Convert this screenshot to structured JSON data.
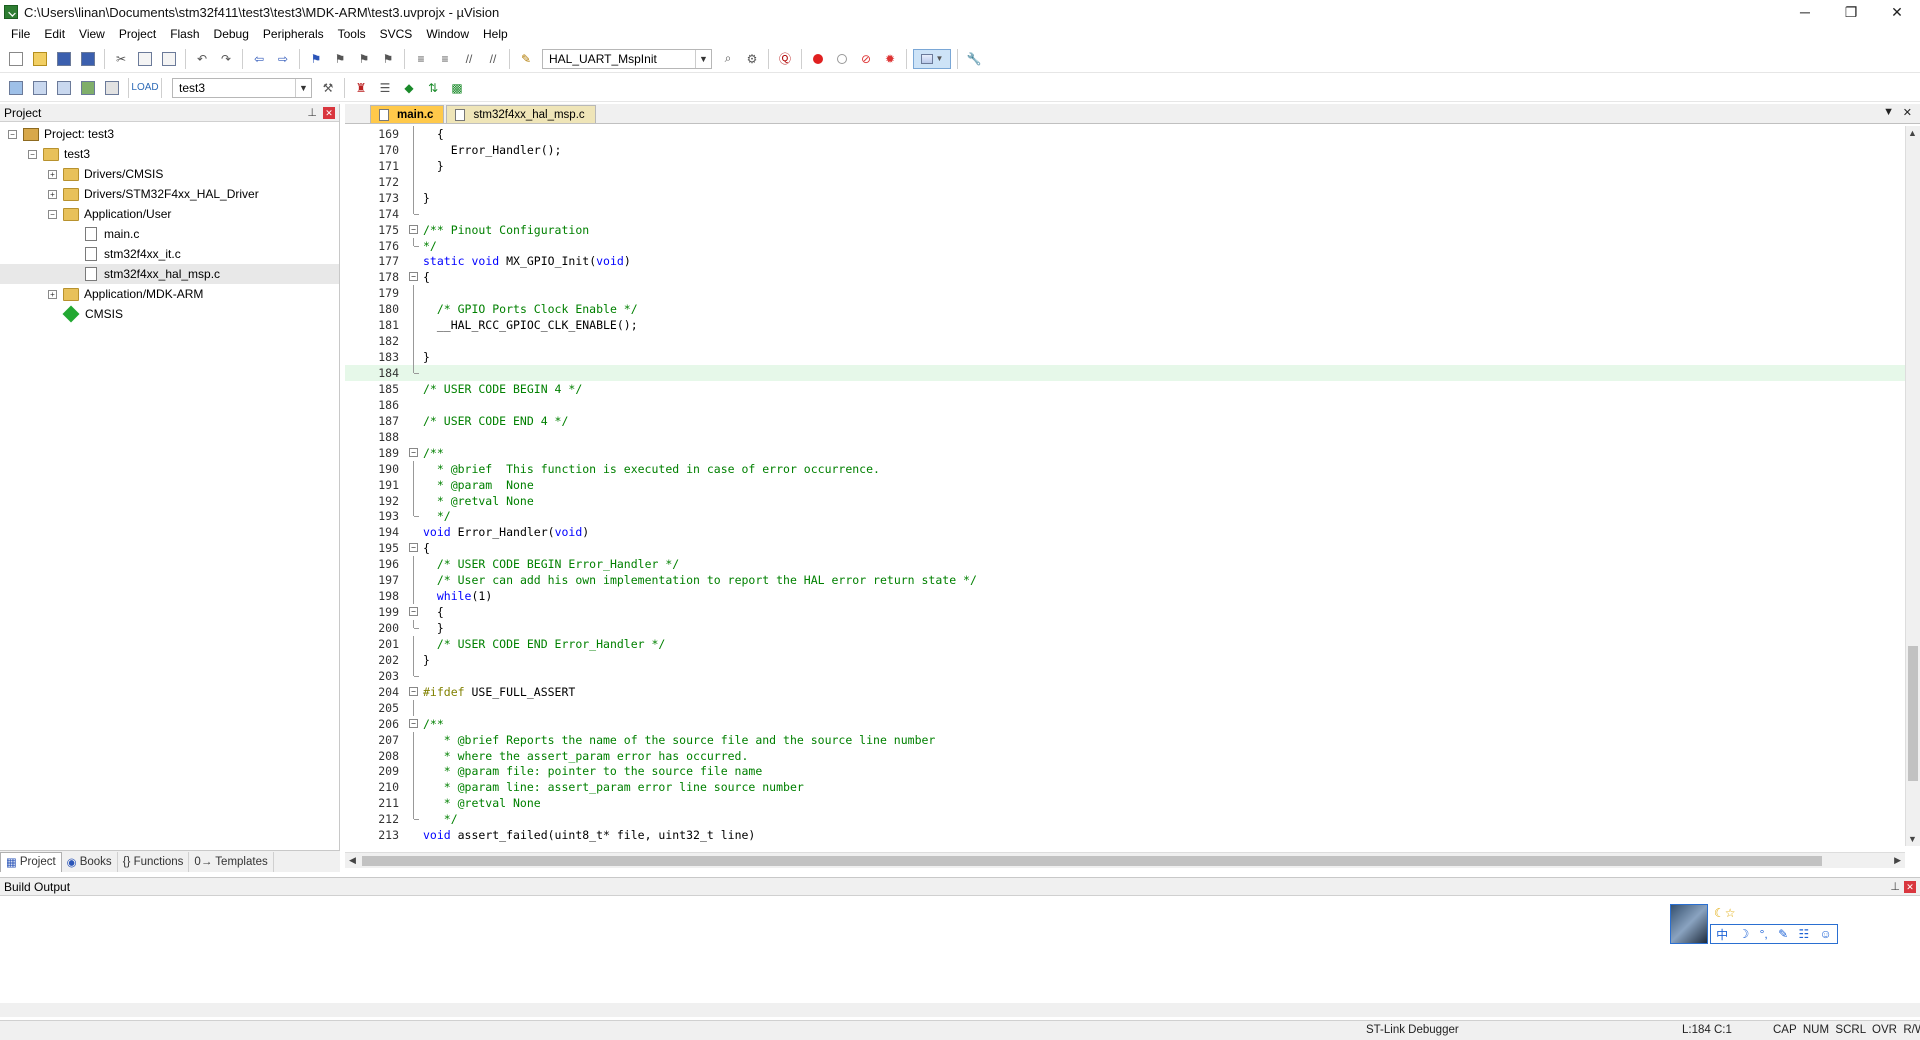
{
  "window": {
    "title": "C:\\Users\\linan\\Documents\\stm32f411\\test3\\test3\\MDK-ARM\\test3.uvprojx - µVision",
    "controls": [
      "─",
      "❐",
      "✕"
    ]
  },
  "menu": [
    "File",
    "Edit",
    "View",
    "Project",
    "Flash",
    "Debug",
    "Peripherals",
    "Tools",
    "SVCS",
    "Window",
    "Help"
  ],
  "toolbar1": {
    "function_combo": "HAL_UART_MspInit"
  },
  "toolbar2": {
    "target_combo": "test3"
  },
  "project_panel": {
    "title": "Project",
    "tree": [
      {
        "label": "Project: test3",
        "level": 0,
        "icon": "project-icon",
        "expander": "⊟"
      },
      {
        "label": "test3",
        "level": 1,
        "icon": "folder-icon",
        "expander": "⊟"
      },
      {
        "label": "Drivers/CMSIS",
        "level": 2,
        "icon": "folder-icon",
        "expander": "⊞"
      },
      {
        "label": "Drivers/STM32F4xx_HAL_Driver",
        "level": 2,
        "icon": "folder-icon",
        "expander": "⊞"
      },
      {
        "label": "Application/User",
        "level": 2,
        "icon": "folder-open-icon",
        "expander": "⊟"
      },
      {
        "label": "main.c",
        "level": 3,
        "icon": "file-icon",
        "expander": ""
      },
      {
        "label": "stm32f4xx_it.c",
        "level": 3,
        "icon": "file-icon",
        "expander": ""
      },
      {
        "label": "stm32f4xx_hal_msp.c",
        "level": 3,
        "icon": "file-icon",
        "expander": "",
        "selected": true
      },
      {
        "label": "Application/MDK-ARM",
        "level": 2,
        "icon": "folder-icon",
        "expander": "⊞"
      },
      {
        "label": "CMSIS",
        "level": 2,
        "icon": "cmsis-gem-icon",
        "expander": ""
      }
    ],
    "tabs": [
      "Project",
      "Books",
      "{} Functions",
      "0→ Templates"
    ]
  },
  "editor": {
    "tabs": [
      {
        "label": "main.c",
        "active": true
      },
      {
        "label": "stm32f4xx_hal_msp.c",
        "active": false
      }
    ],
    "current_line": 184,
    "lines": [
      {
        "n": "169",
        "fold": "vl",
        "segs": [
          [
            "",
            "  {"
          ]
        ]
      },
      {
        "n": "170",
        "fold": "vl",
        "segs": [
          [
            "",
            "    Error_Handler();"
          ]
        ]
      },
      {
        "n": "171",
        "fold": "vl",
        "segs": [
          [
            "",
            "  }"
          ]
        ]
      },
      {
        "n": "172",
        "fold": "vl",
        "segs": [
          [
            "",
            ""
          ]
        ]
      },
      {
        "n": "173",
        "fold": "vl",
        "segs": [
          [
            "",
            "}"
          ]
        ]
      },
      {
        "n": "174",
        "fold": "end",
        "segs": [
          [
            "",
            ""
          ]
        ]
      },
      {
        "n": "175",
        "fold": "box",
        "segs": [
          [
            "cm",
            "/** Pinout Configuration"
          ]
        ]
      },
      {
        "n": "176",
        "fold": "end",
        "segs": [
          [
            "cm",
            "*/"
          ]
        ]
      },
      {
        "n": "177",
        "fold": "",
        "segs": [
          [
            "kw",
            "static"
          ],
          [
            "",
            " "
          ],
          [
            "kw",
            "void"
          ],
          [
            "",
            " MX_GPIO_Init("
          ],
          [
            "kw",
            "void"
          ],
          [
            "",
            ")"
          ]
        ]
      },
      {
        "n": "178",
        "fold": "box",
        "segs": [
          [
            "",
            "{"
          ]
        ]
      },
      {
        "n": "179",
        "fold": "vl",
        "segs": [
          [
            "",
            ""
          ]
        ]
      },
      {
        "n": "180",
        "fold": "vl",
        "segs": [
          [
            "",
            "  "
          ],
          [
            "cm",
            "/* GPIO Ports Clock Enable */"
          ]
        ]
      },
      {
        "n": "181",
        "fold": "vl",
        "segs": [
          [
            "",
            "  __HAL_RCC_GPIOC_CLK_ENABLE();"
          ]
        ]
      },
      {
        "n": "182",
        "fold": "vl",
        "segs": [
          [
            "",
            ""
          ]
        ]
      },
      {
        "n": "183",
        "fold": "vl",
        "segs": [
          [
            "",
            "}"
          ]
        ]
      },
      {
        "n": "184",
        "fold": "end",
        "segs": [
          [
            "",
            ""
          ]
        ]
      },
      {
        "n": "185",
        "fold": "",
        "segs": [
          [
            "cm",
            "/* USER CODE BEGIN 4 */"
          ]
        ]
      },
      {
        "n": "186",
        "fold": "",
        "segs": [
          [
            "",
            ""
          ]
        ]
      },
      {
        "n": "187",
        "fold": "",
        "segs": [
          [
            "cm",
            "/* USER CODE END 4 */"
          ]
        ]
      },
      {
        "n": "188",
        "fold": "",
        "segs": [
          [
            "",
            ""
          ]
        ]
      },
      {
        "n": "189",
        "fold": "box",
        "segs": [
          [
            "cm",
            "/**"
          ]
        ]
      },
      {
        "n": "190",
        "fold": "vl",
        "segs": [
          [
            "cm",
            "  * @brief  This function is executed in case of error occurrence."
          ]
        ]
      },
      {
        "n": "191",
        "fold": "vl",
        "segs": [
          [
            "cm",
            "  * @param  None"
          ]
        ]
      },
      {
        "n": "192",
        "fold": "vl",
        "segs": [
          [
            "cm",
            "  * @retval None"
          ]
        ]
      },
      {
        "n": "193",
        "fold": "end",
        "segs": [
          [
            "cm",
            "  */"
          ]
        ]
      },
      {
        "n": "194",
        "fold": "",
        "segs": [
          [
            "kw",
            "void"
          ],
          [
            "",
            " Error_Handler("
          ],
          [
            "kw",
            "void"
          ],
          [
            "",
            ")"
          ]
        ]
      },
      {
        "n": "195",
        "fold": "box",
        "segs": [
          [
            "",
            "{"
          ]
        ]
      },
      {
        "n": "196",
        "fold": "vl",
        "segs": [
          [
            "",
            "  "
          ],
          [
            "cm",
            "/* USER CODE BEGIN Error_Handler */"
          ]
        ]
      },
      {
        "n": "197",
        "fold": "vl",
        "segs": [
          [
            "",
            "  "
          ],
          [
            "cm",
            "/* User can add his own implementation to report the HAL error return state */"
          ]
        ]
      },
      {
        "n": "198",
        "fold": "vl",
        "segs": [
          [
            "",
            "  "
          ],
          [
            "kw",
            "while"
          ],
          [
            "",
            "(1)"
          ]
        ]
      },
      {
        "n": "199",
        "fold": "box",
        "segs": [
          [
            "",
            "  {"
          ]
        ]
      },
      {
        "n": "200",
        "fold": "end",
        "segs": [
          [
            "",
            "  }"
          ]
        ]
      },
      {
        "n": "201",
        "fold": "vl",
        "segs": [
          [
            "",
            "  "
          ],
          [
            "cm",
            "/* USER CODE END Error_Handler */"
          ]
        ]
      },
      {
        "n": "202",
        "fold": "vl",
        "segs": [
          [
            "",
            "}"
          ]
        ]
      },
      {
        "n": "203",
        "fold": "end",
        "segs": [
          [
            "",
            ""
          ]
        ]
      },
      {
        "n": "204",
        "fold": "box",
        "segs": [
          [
            "pp",
            "#ifdef"
          ],
          [
            "",
            " USE_FULL_ASSERT"
          ]
        ]
      },
      {
        "n": "205",
        "fold": "vl",
        "segs": [
          [
            "",
            ""
          ]
        ]
      },
      {
        "n": "206",
        "fold": "box",
        "segs": [
          [
            "cm",
            "/**"
          ]
        ]
      },
      {
        "n": "207",
        "fold": "vl",
        "segs": [
          [
            "cm",
            "   * @brief Reports the name of the source file and the source line number"
          ]
        ]
      },
      {
        "n": "208",
        "fold": "vl",
        "segs": [
          [
            "cm",
            "   * where the assert_param error has occurred."
          ]
        ]
      },
      {
        "n": "209",
        "fold": "vl",
        "segs": [
          [
            "cm",
            "   * @param file: pointer to the source file name"
          ]
        ]
      },
      {
        "n": "210",
        "fold": "vl",
        "segs": [
          [
            "cm",
            "   * @param line: assert_param error line source number"
          ]
        ]
      },
      {
        "n": "211",
        "fold": "vl",
        "segs": [
          [
            "cm",
            "   * @retval None"
          ]
        ]
      },
      {
        "n": "212",
        "fold": "end",
        "segs": [
          [
            "cm",
            "   */"
          ]
        ]
      },
      {
        "n": "213",
        "fold": "",
        "segs": [
          [
            "kw",
            "void"
          ],
          [
            "",
            " assert_failed(uint8_t* file, uint32_t line)"
          ]
        ]
      }
    ]
  },
  "build_output": {
    "title": "Build Output"
  },
  "ime": {
    "chars": [
      "中",
      "☽",
      "°,",
      "✎",
      "☷",
      "☺"
    ],
    "top": "☾☆"
  },
  "status": {
    "debugger": "ST-Link Debugger",
    "position": "L:184 C:1",
    "indicators": "CAP  NUM  SCRL  OVR  R/W"
  },
  "colors": {
    "keyword": "#0000ff",
    "comment": "#008000",
    "preprocessor": "#808000",
    "current_line": "#e6f8e9",
    "active_tab": "#ffc94a"
  }
}
